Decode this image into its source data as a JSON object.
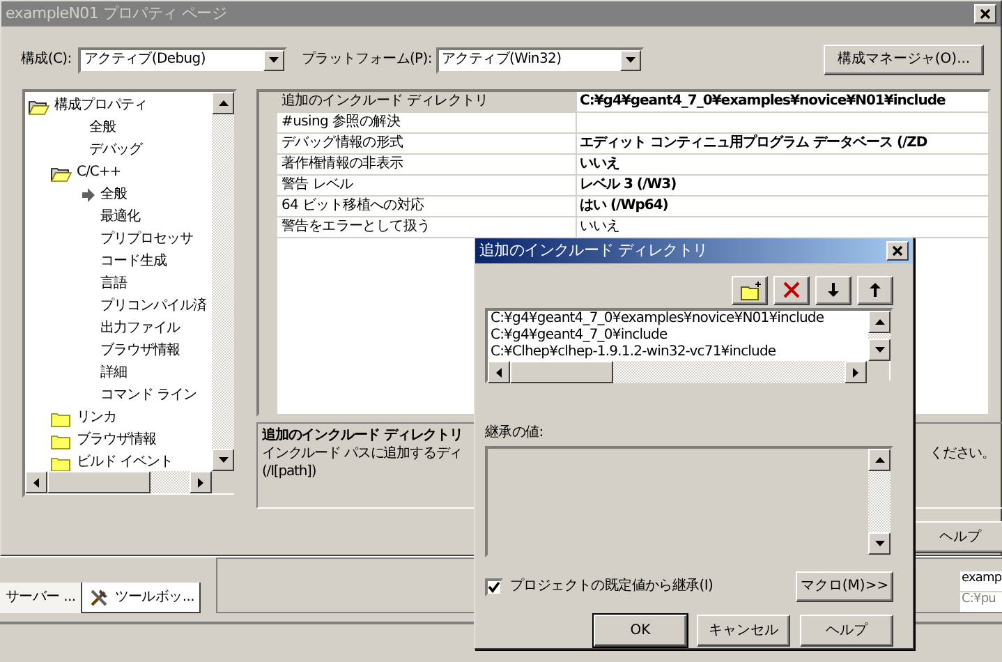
{
  "window": {
    "title": "exampleN01 プロパティ ページ"
  },
  "config_label": "構成(C):",
  "config_value": "アクティブ(Debug)",
  "platform_label": "プラットフォーム(P):",
  "platform_value": "アクティブ(Win32)",
  "config_manager_button": "構成マネージャ(O)...",
  "tree": [
    {
      "label": "構成プロパティ",
      "kind": "folder",
      "expanded": true,
      "selected": false,
      "children": [
        {
          "label": "全般",
          "kind": "page",
          "selected": false
        },
        {
          "label": "デバッグ",
          "kind": "page",
          "selected": false
        },
        {
          "label": "C/C++",
          "kind": "folder",
          "expanded": true,
          "selected": false,
          "children": [
            {
              "label": "全般",
              "kind": "page",
              "selected": true
            },
            {
              "label": "最適化",
              "kind": "page",
              "selected": false
            },
            {
              "label": "プリプロセッサ",
              "kind": "page",
              "selected": false
            },
            {
              "label": "コード生成",
              "kind": "page",
              "selected": false
            },
            {
              "label": "言語",
              "kind": "page",
              "selected": false
            },
            {
              "label": "プリコンパイル済",
              "kind": "page",
              "selected": false
            },
            {
              "label": "出力ファイル",
              "kind": "page",
              "selected": false
            },
            {
              "label": "ブラウザ情報",
              "kind": "page",
              "selected": false
            },
            {
              "label": "詳細",
              "kind": "page",
              "selected": false
            },
            {
              "label": "コマンド ライン",
              "kind": "page",
              "selected": false
            }
          ]
        },
        {
          "label": "リンカ",
          "kind": "folder",
          "expanded": false,
          "selected": false
        },
        {
          "label": "ブラウザ情報",
          "kind": "folder",
          "expanded": false,
          "selected": false
        },
        {
          "label": "ビルド イベント",
          "kind": "folder",
          "expanded": false,
          "selected": false
        }
      ]
    }
  ],
  "properties": [
    {
      "name": "追加のインクルード ディレクトリ",
      "value": "C:¥g4¥geant4_7_0¥examples¥novice¥N01¥include",
      "bold": true
    },
    {
      "name": "#using 参照の解決"
    },
    {
      "name": "デバッグ情報の形式",
      "value": "エディット コンティニュ用プログラム データベース (/ZD",
      "bold": true
    },
    {
      "name": "著作権情報の非表示",
      "value": "いいえ",
      "bold": true
    },
    {
      "name": "警告 レベル",
      "value": "レベル 3 (/W3)",
      "bold": true
    },
    {
      "name": "64 ビット移植への対応",
      "value": "はい (/Wp64)",
      "bold": true
    },
    {
      "name": "警告をエラーとして扱う",
      "value": "いいえ",
      "bold": false
    }
  ],
  "description": {
    "title": "追加のインクルード ディレクトリ",
    "text_left": "インクルード パスに追加するディ",
    "text_right": "ください。",
    "syntax": "(/I[path])"
  },
  "help_button": "ヘルプ",
  "ide": {
    "tabs": [
      {
        "label": "サーバー ...",
        "selected": false
      },
      {
        "label": "ツールボッ...",
        "selected": true
      }
    ],
    "cells": [
      "examp",
      "C:¥pu"
    ]
  },
  "dialog": {
    "title": "追加のインクルード ディレクトリ",
    "directories": [
      "C:¥g4¥geant4_7_0¥examples¥novice¥N01¥include",
      "C:¥g4¥geant4_7_0¥include",
      "C:¥Clhep¥clhep-1.9.1.2-win32-vc71¥include"
    ],
    "inherited_label": "継承の値:",
    "inherit_checkbox": {
      "label": "プロジェクトの既定値から継承(I)",
      "checked": true
    },
    "macro_button": "マクロ(M)>>",
    "buttons": [
      "OK",
      "キャンセル",
      "ヘルプ"
    ]
  }
}
